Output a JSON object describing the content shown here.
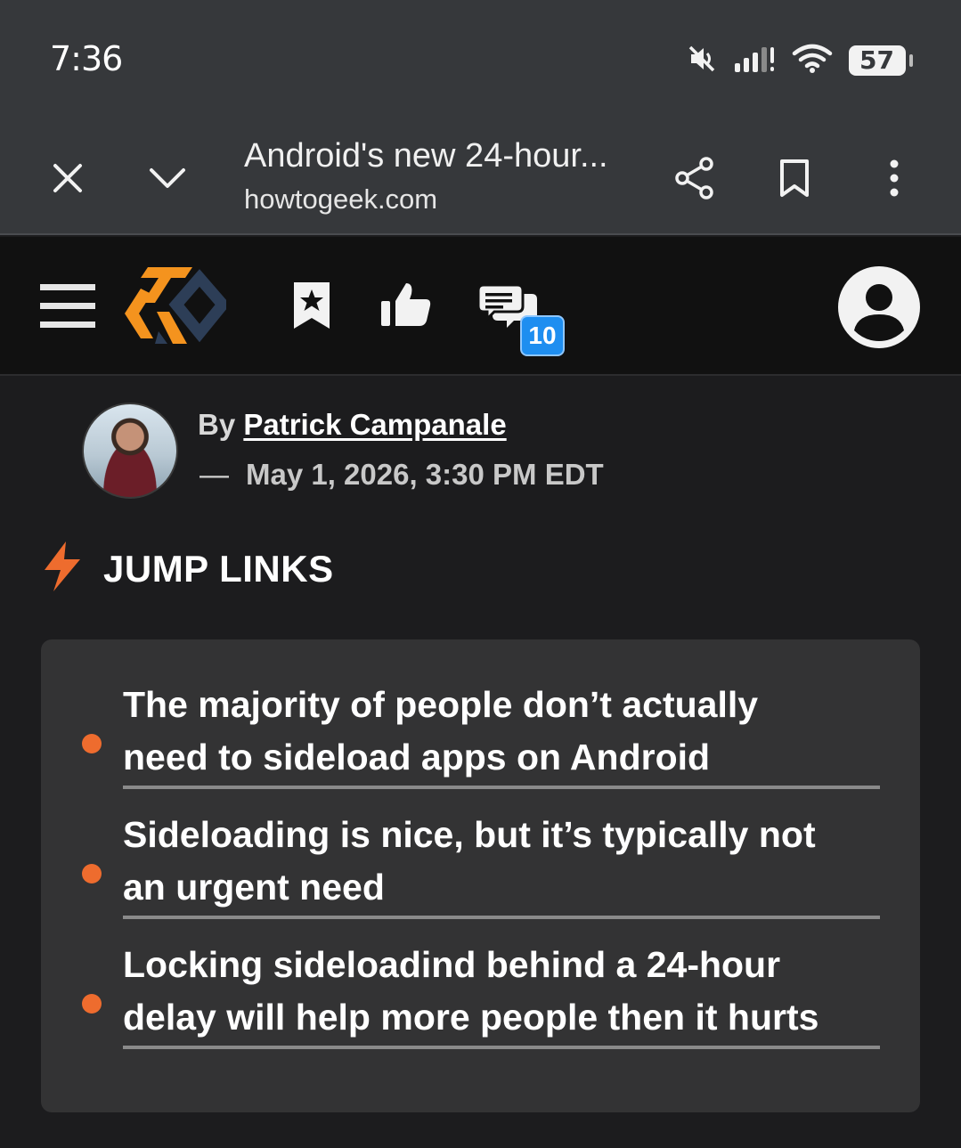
{
  "status": {
    "time": "7:36",
    "battery": "57",
    "icons": [
      "mute-icon",
      "signal-icon",
      "wifi-icon",
      "battery-icon"
    ]
  },
  "browser": {
    "title": "Android's new 24-hour...",
    "url": "howtogeek.com",
    "icons": [
      "close-icon",
      "chevron-down-icon",
      "share-icon",
      "bookmark-icon",
      "more-vert-icon"
    ]
  },
  "site": {
    "comment_count": "10",
    "colors": {
      "logo_orange": "#f4931e",
      "logo_navy": "#2d3e57",
      "badge_blue": "#1e8ef0"
    }
  },
  "article": {
    "by_label": "By",
    "author": "Patrick Campanale",
    "dash": "—",
    "date": "May 1, 2026, 3:30 PM EDT"
  },
  "jump_links": {
    "title": "JUMP LINKS",
    "items": [
      {
        "line1": "The majority of people don’t actually",
        "line2": "need to sideload apps on Android"
      },
      {
        "line1": "Sideloading is nice, but it’s typically not",
        "line2": "an urgent need"
      },
      {
        "line1": "Locking sideloadind behind a 24-hour",
        "line2": "delay will help more people then it hurts"
      }
    ],
    "accent": "#ee6c2e"
  }
}
